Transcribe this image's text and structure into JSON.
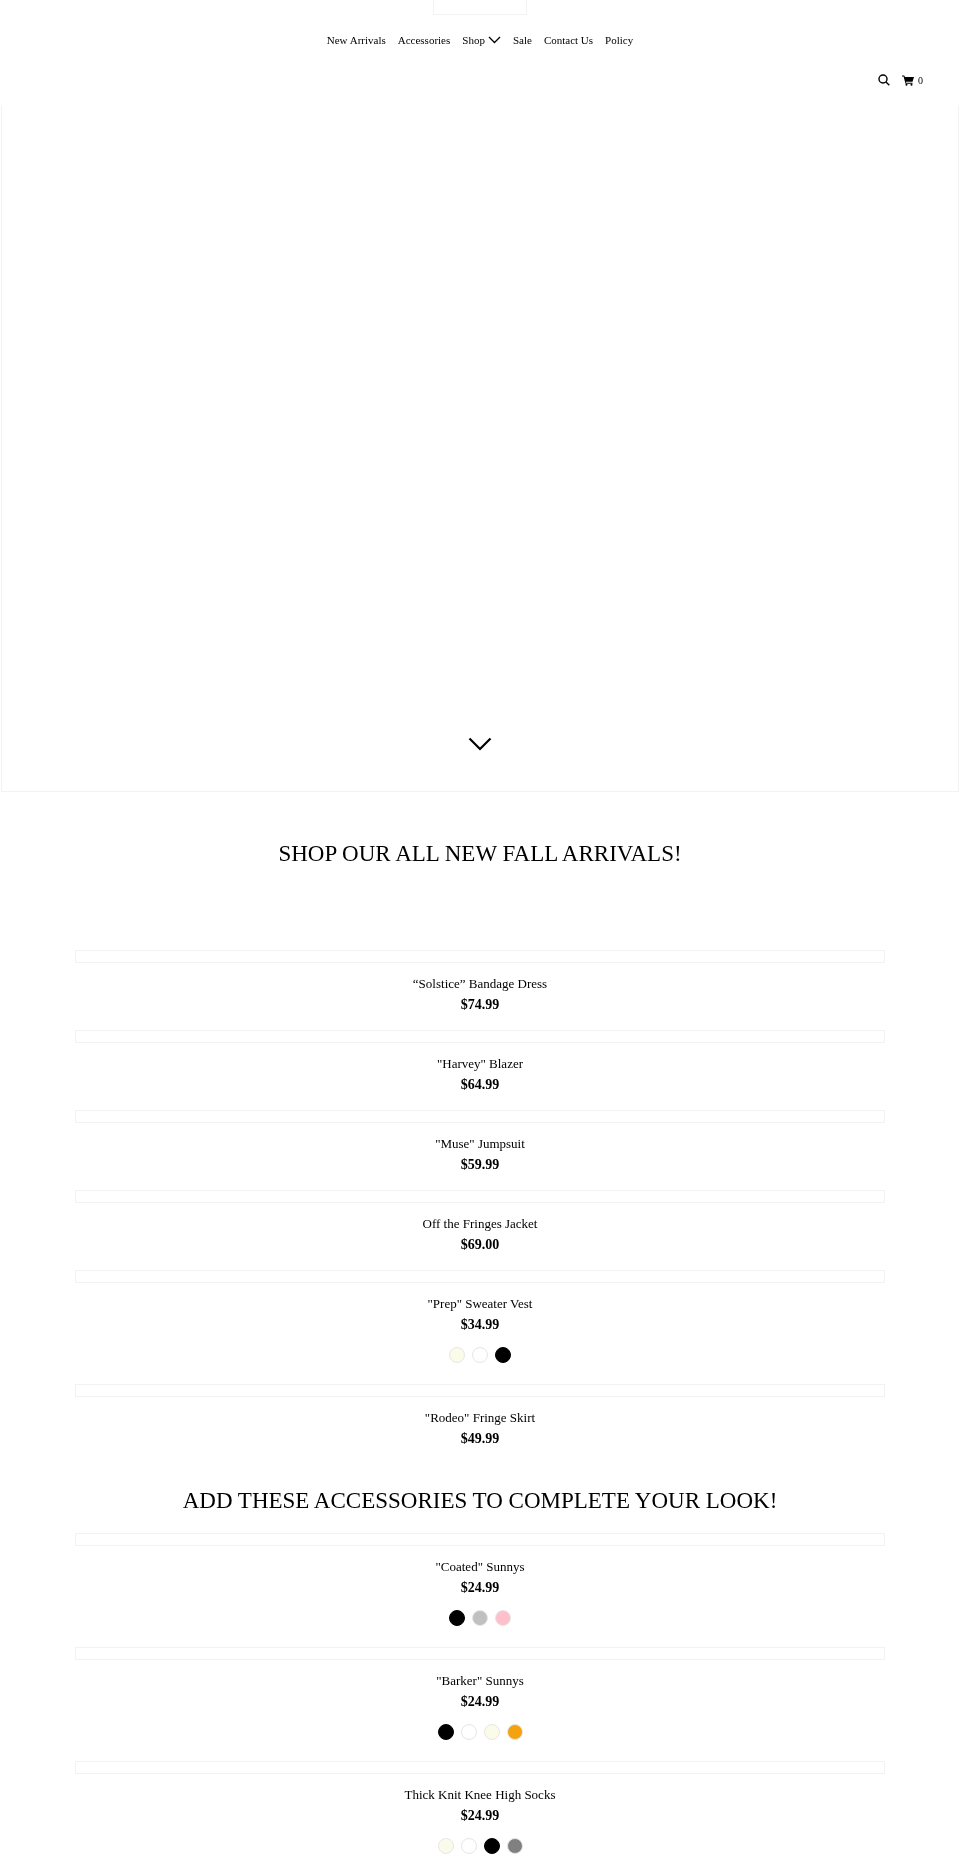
{
  "nav": {
    "items": [
      {
        "label": "New Arrivals",
        "kind": "link"
      },
      {
        "label": "Accessories",
        "kind": "link"
      },
      {
        "label": "Shop",
        "kind": "dropdown"
      },
      {
        "label": "Sale",
        "kind": "link"
      },
      {
        "label": "Contact Us",
        "kind": "link"
      },
      {
        "label": "Policy",
        "kind": "link"
      }
    ],
    "cart_count": "0"
  },
  "sections": [
    {
      "heading": "SHOP OUR ALL NEW FALL ARRIVALS!",
      "products": [
        {
          "name": "“Solstice” Bandage Dress",
          "price": "$74.99"
        },
        {
          "name": "\"Harvey\" Blazer",
          "price": "$64.99"
        },
        {
          "name": "\"Muse\" Jumpsuit",
          "price": "$59.99"
        },
        {
          "name": "Off the Fringes Jacket",
          "price": "$69.00"
        },
        {
          "name": "\"Prep\" Sweater Vest",
          "price": "$34.99",
          "swatches": [
            {
              "color": "#fbfbe9"
            },
            {
              "color": "#ffffff"
            },
            {
              "color": "#000000"
            }
          ]
        },
        {
          "name": "\"Rodeo\" Fringe Skirt",
          "price": "$49.99"
        }
      ]
    },
    {
      "heading": "ADD THESE ACCESSORIES TO COMPLETE YOUR LOOK!",
      "products": [
        {
          "name": "\"Coated\" Sunnys",
          "price": "$24.99",
          "swatches": [
            {
              "color": "#000000"
            },
            {
              "color": "#c0c0c0"
            },
            {
              "color": "#ffc0cb"
            }
          ]
        },
        {
          "name": "\"Barker\" Sunnys",
          "price": "$24.99",
          "swatches": [
            {
              "color": "#000000"
            },
            {
              "color": "#ffffff"
            },
            {
              "color": "#fbfbe9"
            },
            {
              "color": "#f4a20f"
            }
          ]
        },
        {
          "name": "Thick Knit Knee High Socks",
          "price": "$24.99",
          "swatches": [
            {
              "color": "#fbfbe9"
            },
            {
              "color": "#ffffff"
            },
            {
              "color": "#000000"
            },
            {
              "color": "#808080"
            }
          ]
        }
      ]
    }
  ]
}
